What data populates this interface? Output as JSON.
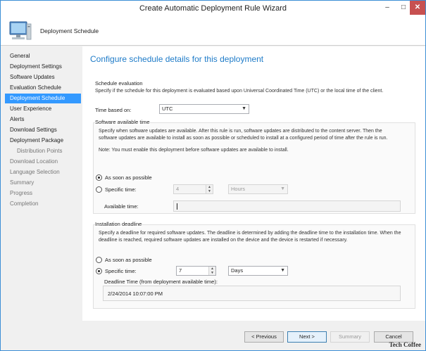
{
  "window": {
    "title": "Create Automatic Deployment Rule Wizard"
  },
  "header": {
    "title": "Deployment Schedule"
  },
  "nav": {
    "items": [
      {
        "label": "General"
      },
      {
        "label": "Deployment Settings"
      },
      {
        "label": "Software Updates"
      },
      {
        "label": "Evaluation Schedule"
      },
      {
        "label": "Deployment Schedule"
      },
      {
        "label": "User Experience"
      },
      {
        "label": "Alerts"
      },
      {
        "label": "Download Settings"
      },
      {
        "label": "Deployment Package"
      },
      {
        "label": "Distribution Points"
      },
      {
        "label": "Download Location"
      },
      {
        "label": "Language Selection"
      },
      {
        "label": "Summary"
      },
      {
        "label": "Progress"
      },
      {
        "label": "Completion"
      }
    ]
  },
  "main": {
    "heading": "Configure schedule details for this deployment",
    "schedule_evaluation": {
      "label": "Schedule evaluation",
      "description": "Specify if the schedule for this deployment is evaluated based upon Universal Coordinated Time (UTC) or the local time of the client.",
      "time_based_on_label": "Time based on:",
      "time_based_on_value": "UTC"
    },
    "software_available": {
      "label": "Software available time",
      "description": "Specify when software updates are available. After this rule is run, software updates are distributed to the content server. Then the software updates are available to install as soon as possible or scheduled to install at a configured period of time after the rule is run.",
      "note": "Note: You must enable this deployment before software updates are available to install.",
      "asap_label": "As soon as possible",
      "specific_label": "Specific time:",
      "specific_value": "4",
      "unit_value": "Hours",
      "available_time_label": "Available time:"
    },
    "installation_deadline": {
      "label": "Installation deadline",
      "description": "Specify a deadline for required software updates. The deadline is determined by adding the deadline time to the installation time. When the deadline is reached, required software updates are installed on the device and the device is restarted if necessary.",
      "asap_label": "As soon as possible",
      "specific_label": "Specific time:",
      "specific_value": "7",
      "unit_value": "Days",
      "deadline_time_label": "Deadline Time (from deployment available time):",
      "deadline_time_value": "2/24/2014 10:07:00 PM"
    }
  },
  "footer": {
    "previous_label": "< Previous",
    "next_label": "Next >",
    "summary_label": "Summary",
    "cancel_label": "Cancel"
  },
  "watermark": "Tech Coffee",
  "colors": {
    "accent": "#1e7bc8",
    "selection": "#3399ff",
    "close": "#c75050"
  }
}
